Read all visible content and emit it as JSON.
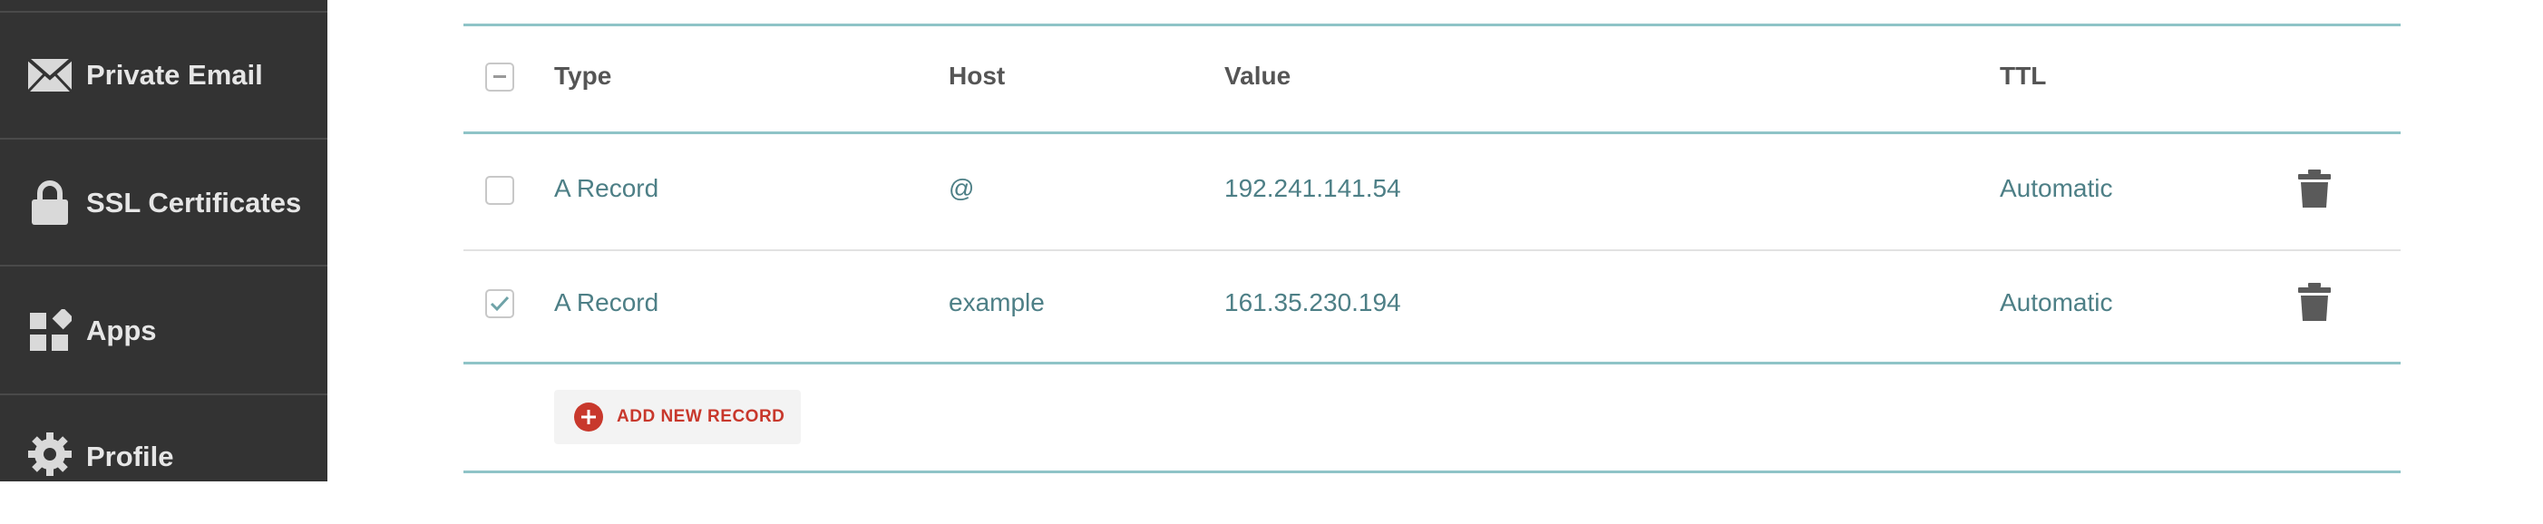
{
  "sidebar": {
    "items": [
      {
        "label": "Private Email",
        "icon": "envelope-icon"
      },
      {
        "label": "SSL Certificates",
        "icon": "lock-icon"
      },
      {
        "label": "Apps",
        "icon": "apps-icon"
      },
      {
        "label": "Profile",
        "icon": "gear-icon"
      }
    ]
  },
  "table": {
    "headers": {
      "type": "Type",
      "host": "Host",
      "value": "Value",
      "ttl": "TTL"
    },
    "rows": [
      {
        "type": "A Record",
        "host": "@",
        "value": "192.241.141.54",
        "ttl": "Automatic",
        "checked": false
      },
      {
        "type": "A Record",
        "host": "example",
        "value": "161.35.230.194",
        "ttl": "Automatic",
        "checked": true
      }
    ],
    "add_label": "ADD NEW RECORD"
  },
  "colors": {
    "sidebar_bg": "#333333",
    "accent_line": "#8fc4c7",
    "value_text": "#4d7f86",
    "add_red": "#c8382c"
  }
}
